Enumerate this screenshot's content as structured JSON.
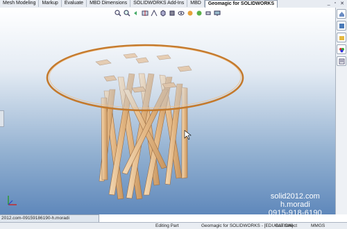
{
  "tabs": [
    "Mesh Modeling",
    "Markup",
    "Evaluate",
    "MBD Dimensions",
    "SOLIDWORKS Add-Ins",
    "MBD",
    "Geomagic for SOLIDWORKS"
  ],
  "active_tab": "Geomagic for SOLIDWORKS",
  "window_controls": [
    "_",
    "▫",
    "✕"
  ],
  "hud_icons": [
    "zoom-to-fit-icon",
    "zoom-area-icon",
    "previous-view-icon",
    "section-view-icon",
    "dynamic-annotation-icon",
    "view-orientation-icon",
    "display-style-icon",
    "hide-show-icon",
    "edit-appearance-icon",
    "apply-scene-icon",
    "view-settings-icon",
    "monitor-icon"
  ],
  "taskpane_icons": [
    "home-icon",
    "design-library-icon",
    "file-explorer-icon",
    "appearances-icon",
    "custom-properties-icon"
  ],
  "watermark": {
    "line1": "solid2012.com",
    "line2": "h.moradi",
    "line3": "0915-918-6190"
  },
  "doc_tab": "2012.com-09159186190-h.moradi",
  "status": {
    "mode": "Editing Part",
    "addin": "Geomagic for SOLIDWORKS - [EDUCATION]",
    "select": "Box Select",
    "units": "MMGS"
  },
  "colors": {
    "glass_edge": "#c47a2d",
    "wood": "#e8c49a",
    "wood_dark": "#b98a5e",
    "bg_bottom": "#5f88bb"
  }
}
